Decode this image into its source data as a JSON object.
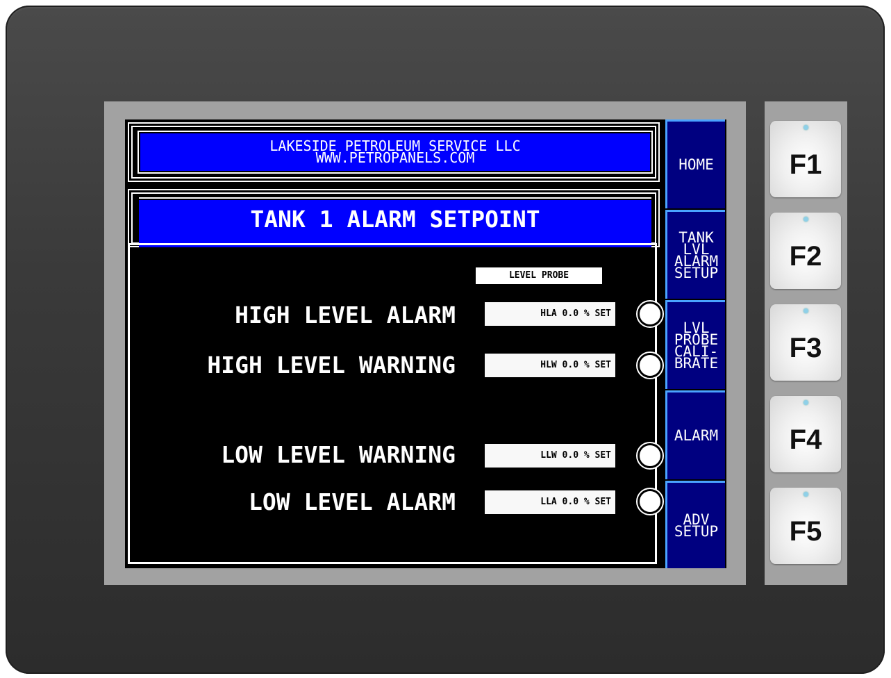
{
  "header": {
    "line1": "LAKESIDE PETROLEUM SERVICE LLC",
    "line2": "WWW.PETROPANELS.COM"
  },
  "title": "TANK 1 ALARM SETPOINT",
  "probe_label": "LEVEL PROBE",
  "rows": [
    {
      "label": "HIGH LEVEL ALARM",
      "value": "HLA 0.0 % SET",
      "lamp_on": true
    },
    {
      "label": "HIGH LEVEL WARNING",
      "value": "HLW 0.0 % SET",
      "lamp_on": true
    },
    {
      "label": "LOW LEVEL WARNING",
      "value": "LLW 0.0 % SET",
      "lamp_on": true
    },
    {
      "label": "LOW LEVEL ALARM",
      "value": "LLA 0.0 % SET",
      "lamp_on": true
    }
  ],
  "side_buttons": [
    {
      "label": "HOME"
    },
    {
      "label": "TANK\nLVL\nALARM\nSETUP"
    },
    {
      "label": "LVL\nPROBE\nCALI-\nBRATE"
    },
    {
      "label": "ALARM"
    },
    {
      "label": "ADV\nSETUP"
    }
  ],
  "function_keys": [
    "F1",
    "F2",
    "F3",
    "F4",
    "F5"
  ],
  "colors": {
    "bezel": "#3a3a3a",
    "frame": "#a2a2a2",
    "banner_blue": "#0000ff",
    "button_navy": "#000080",
    "button_edge": "#4aa3ff"
  }
}
